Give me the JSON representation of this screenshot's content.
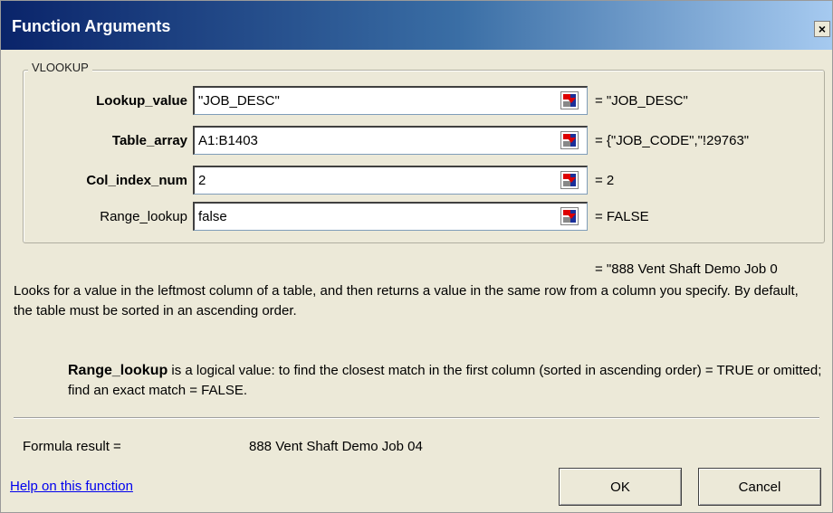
{
  "window": {
    "title": "Function Arguments",
    "close_label": "×"
  },
  "function_name": "VLOOKUP",
  "arguments": [
    {
      "label": "Lookup_value",
      "bold": true,
      "value": "\"JOB_DESC\"",
      "result": "= \"JOB_DESC\""
    },
    {
      "label": "Table_array",
      "bold": true,
      "value": "A1:B1403",
      "result": "= {\"JOB_CODE\",\"!29763\""
    },
    {
      "label": "Col_index_num",
      "bold": true,
      "value": "2",
      "result": "= 2"
    },
    {
      "label": "Range_lookup",
      "bold": false,
      "value": "false",
      "result": "= FALSE"
    }
  ],
  "overall_result": "= \"888 Vent Shaft Demo Job 0",
  "description": "Looks for a value in the leftmost column of a table, and then returns a value in the same row from a column you specify. By default, the table must be sorted in an ascending order.",
  "arg_help": {
    "name": "Range_lookup",
    "text": "is a logical value: to find the closest match in the first column (sorted in ascending order) = TRUE or omitted; find an exact match = FALSE."
  },
  "formula_result": {
    "label": "Formula result =",
    "value": "888 Vent Shaft Demo Job 04"
  },
  "help_link": "Help on this function",
  "buttons": {
    "ok": "OK",
    "cancel": "Cancel"
  }
}
